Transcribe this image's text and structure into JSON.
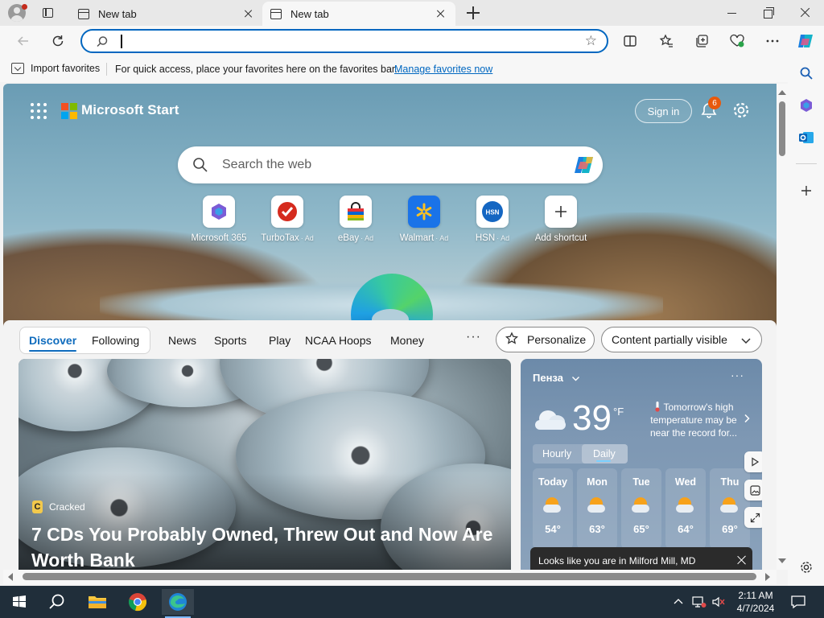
{
  "browser": {
    "tabs": [
      {
        "title": "New tab",
        "active": false
      },
      {
        "title": "New tab",
        "active": true
      }
    ],
    "address_bar": {
      "value": "",
      "placeholder": ""
    },
    "favorites_bar": {
      "import_label": "Import favorites",
      "message": "For quick access, place your favorites here on the favorites bar.",
      "manage_link": "Manage favorites now"
    }
  },
  "start": {
    "brand": "Microsoft Start",
    "sign_in": "Sign in",
    "notification_count": "6",
    "search_placeholder": "Search the web",
    "shortcuts": [
      {
        "label": "Microsoft 365",
        "ad": ""
      },
      {
        "label": "TurboTax",
        "ad": "Ad"
      },
      {
        "label": "eBay",
        "ad": "Ad"
      },
      {
        "label": "Walmart",
        "ad": "Ad"
      },
      {
        "label": "HSN",
        "ad": "Ad"
      },
      {
        "label": "Add shortcut",
        "ad": ""
      }
    ],
    "feed_nav": {
      "items": [
        "Discover",
        "Following",
        "News",
        "Sports",
        "Play",
        "NCAA Hoops",
        "Money"
      ],
      "more": "···",
      "personalize": "Personalize",
      "content_visibility": "Content partially visible"
    },
    "article": {
      "source": "Cracked",
      "source_initial": "C",
      "headline": "7 CDs You Probably Owned, Threw Out and Now Are Worth Bank"
    },
    "weather": {
      "location": "Пенза",
      "temperature": "39",
      "unit": "°F",
      "note": "Tomorrow's high temperature may be near the record for...",
      "tabs": [
        "Hourly",
        "Daily"
      ],
      "selected_tab": "Daily",
      "days": [
        {
          "day": "Today",
          "temp": "54°"
        },
        {
          "day": "Mon",
          "temp": "63°"
        },
        {
          "day": "Tue",
          "temp": "65°"
        },
        {
          "day": "Wed",
          "temp": "64°"
        },
        {
          "day": "Thu",
          "temp": "69°"
        }
      ],
      "toast": "Looks like you are in Milford Mill, MD"
    }
  },
  "taskbar": {
    "time": "2:11 AM",
    "date": "4/7/2024"
  },
  "colors": {
    "accent": "#0067c0",
    "nav_active": "#0f6cbd",
    "notification_badge": "#e8590c",
    "taskbar": "#202e3a"
  }
}
